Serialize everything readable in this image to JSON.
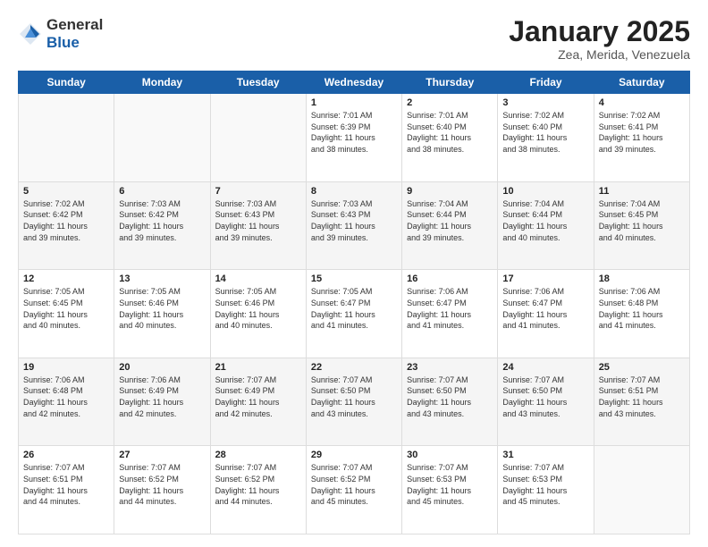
{
  "header": {
    "logo_general": "General",
    "logo_blue": "Blue",
    "month_title": "January 2025",
    "location": "Zea, Merida, Venezuela"
  },
  "weekdays": [
    "Sunday",
    "Monday",
    "Tuesday",
    "Wednesday",
    "Thursday",
    "Friday",
    "Saturday"
  ],
  "weeks": [
    [
      {
        "day": "",
        "info": ""
      },
      {
        "day": "",
        "info": ""
      },
      {
        "day": "",
        "info": ""
      },
      {
        "day": "1",
        "info": "Sunrise: 7:01 AM\nSunset: 6:39 PM\nDaylight: 11 hours\nand 38 minutes."
      },
      {
        "day": "2",
        "info": "Sunrise: 7:01 AM\nSunset: 6:40 PM\nDaylight: 11 hours\nand 38 minutes."
      },
      {
        "day": "3",
        "info": "Sunrise: 7:02 AM\nSunset: 6:40 PM\nDaylight: 11 hours\nand 38 minutes."
      },
      {
        "day": "4",
        "info": "Sunrise: 7:02 AM\nSunset: 6:41 PM\nDaylight: 11 hours\nand 39 minutes."
      }
    ],
    [
      {
        "day": "5",
        "info": "Sunrise: 7:02 AM\nSunset: 6:42 PM\nDaylight: 11 hours\nand 39 minutes."
      },
      {
        "day": "6",
        "info": "Sunrise: 7:03 AM\nSunset: 6:42 PM\nDaylight: 11 hours\nand 39 minutes."
      },
      {
        "day": "7",
        "info": "Sunrise: 7:03 AM\nSunset: 6:43 PM\nDaylight: 11 hours\nand 39 minutes."
      },
      {
        "day": "8",
        "info": "Sunrise: 7:03 AM\nSunset: 6:43 PM\nDaylight: 11 hours\nand 39 minutes."
      },
      {
        "day": "9",
        "info": "Sunrise: 7:04 AM\nSunset: 6:44 PM\nDaylight: 11 hours\nand 39 minutes."
      },
      {
        "day": "10",
        "info": "Sunrise: 7:04 AM\nSunset: 6:44 PM\nDaylight: 11 hours\nand 40 minutes."
      },
      {
        "day": "11",
        "info": "Sunrise: 7:04 AM\nSunset: 6:45 PM\nDaylight: 11 hours\nand 40 minutes."
      }
    ],
    [
      {
        "day": "12",
        "info": "Sunrise: 7:05 AM\nSunset: 6:45 PM\nDaylight: 11 hours\nand 40 minutes."
      },
      {
        "day": "13",
        "info": "Sunrise: 7:05 AM\nSunset: 6:46 PM\nDaylight: 11 hours\nand 40 minutes."
      },
      {
        "day": "14",
        "info": "Sunrise: 7:05 AM\nSunset: 6:46 PM\nDaylight: 11 hours\nand 40 minutes."
      },
      {
        "day": "15",
        "info": "Sunrise: 7:05 AM\nSunset: 6:47 PM\nDaylight: 11 hours\nand 41 minutes."
      },
      {
        "day": "16",
        "info": "Sunrise: 7:06 AM\nSunset: 6:47 PM\nDaylight: 11 hours\nand 41 minutes."
      },
      {
        "day": "17",
        "info": "Sunrise: 7:06 AM\nSunset: 6:47 PM\nDaylight: 11 hours\nand 41 minutes."
      },
      {
        "day": "18",
        "info": "Sunrise: 7:06 AM\nSunset: 6:48 PM\nDaylight: 11 hours\nand 41 minutes."
      }
    ],
    [
      {
        "day": "19",
        "info": "Sunrise: 7:06 AM\nSunset: 6:48 PM\nDaylight: 11 hours\nand 42 minutes."
      },
      {
        "day": "20",
        "info": "Sunrise: 7:06 AM\nSunset: 6:49 PM\nDaylight: 11 hours\nand 42 minutes."
      },
      {
        "day": "21",
        "info": "Sunrise: 7:07 AM\nSunset: 6:49 PM\nDaylight: 11 hours\nand 42 minutes."
      },
      {
        "day": "22",
        "info": "Sunrise: 7:07 AM\nSunset: 6:50 PM\nDaylight: 11 hours\nand 43 minutes."
      },
      {
        "day": "23",
        "info": "Sunrise: 7:07 AM\nSunset: 6:50 PM\nDaylight: 11 hours\nand 43 minutes."
      },
      {
        "day": "24",
        "info": "Sunrise: 7:07 AM\nSunset: 6:50 PM\nDaylight: 11 hours\nand 43 minutes."
      },
      {
        "day": "25",
        "info": "Sunrise: 7:07 AM\nSunset: 6:51 PM\nDaylight: 11 hours\nand 43 minutes."
      }
    ],
    [
      {
        "day": "26",
        "info": "Sunrise: 7:07 AM\nSunset: 6:51 PM\nDaylight: 11 hours\nand 44 minutes."
      },
      {
        "day": "27",
        "info": "Sunrise: 7:07 AM\nSunset: 6:52 PM\nDaylight: 11 hours\nand 44 minutes."
      },
      {
        "day": "28",
        "info": "Sunrise: 7:07 AM\nSunset: 6:52 PM\nDaylight: 11 hours\nand 44 minutes."
      },
      {
        "day": "29",
        "info": "Sunrise: 7:07 AM\nSunset: 6:52 PM\nDaylight: 11 hours\nand 45 minutes."
      },
      {
        "day": "30",
        "info": "Sunrise: 7:07 AM\nSunset: 6:53 PM\nDaylight: 11 hours\nand 45 minutes."
      },
      {
        "day": "31",
        "info": "Sunrise: 7:07 AM\nSunset: 6:53 PM\nDaylight: 11 hours\nand 45 minutes."
      },
      {
        "day": "",
        "info": ""
      }
    ]
  ]
}
